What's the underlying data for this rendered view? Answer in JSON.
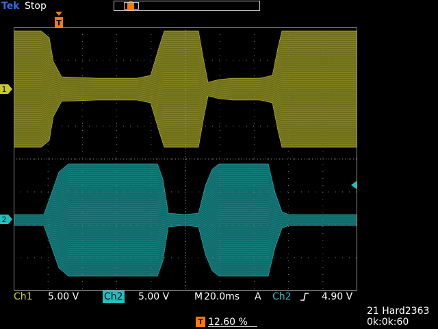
{
  "header": {
    "brand": "Tek",
    "run_state": "Stop"
  },
  "channels": [
    {
      "id": "1",
      "label": "Ch1",
      "scale": "5.00 V",
      "color": "#c8c830"
    },
    {
      "id": "2",
      "label": "Ch2",
      "scale": "5.00 V",
      "color": "#20c0c0"
    }
  ],
  "timebase": {
    "label": "M",
    "value": "20.0ms"
  },
  "trigger": {
    "mode": "A",
    "source": "Ch2",
    "slope_icon": "rising-edge-icon",
    "level": "4.90 V",
    "position_icon_label": "T"
  },
  "trigger_position": {
    "icon_label": "T",
    "value": "12.60 %"
  },
  "footer": {
    "file": "21 Hard2363",
    "timer": "0k:0k:60"
  },
  "colors": {
    "grid": "#7a7a7a",
    "frame": "#909090",
    "trigger": "#ff7a00"
  }
}
